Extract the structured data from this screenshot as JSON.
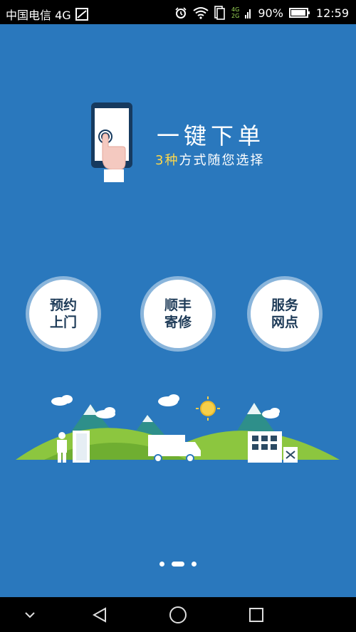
{
  "status_bar": {
    "carrier": "中国电信 4G",
    "battery": "90%",
    "time": "12:59",
    "signal_label_top": "4G",
    "signal_label_bottom": "2G"
  },
  "hero": {
    "title": "一键下单",
    "subtitle_number": "3种",
    "subtitle_rest": "方式随您选择"
  },
  "actions": [
    {
      "label": "预约\n上门"
    },
    {
      "label": "顺丰\n寄修"
    },
    {
      "label": "服务\n网点"
    }
  ],
  "pager": {
    "pages": 3,
    "active_index": 1
  },
  "colors": {
    "background": "#2a78bd",
    "accent": "#ffd84a",
    "button_text": "#1e3b58",
    "hill": "#8cc63f"
  },
  "icons": {
    "nav": [
      "chevron-down-icon",
      "back-icon",
      "home-icon",
      "recents-icon"
    ]
  }
}
